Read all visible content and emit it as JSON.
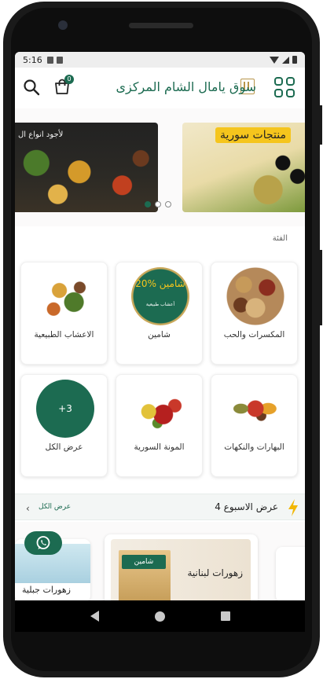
{
  "status_bar": {
    "time": "5:16"
  },
  "header": {
    "title": "سوق يامال الشام المركزى",
    "cart_count": "0"
  },
  "carousel": {
    "banner1_text": "لأجود انواع ال",
    "banner2_text": "منتجات سورية",
    "active_index": 0
  },
  "categories": {
    "section_label": "الفئة",
    "items": [
      {
        "label": "المكسرات والحب",
        "icon": "nuts-image"
      },
      {
        "label": "شامين",
        "icon": "shamin-logo",
        "badge_text": "20% شامين",
        "badge_sub": "أعشاب طبيعية"
      },
      {
        "label": "الاعشاب الطبيعية",
        "icon": "herbs-image"
      },
      {
        "label": "البهارات والنكهات",
        "icon": "spices-image"
      },
      {
        "label": "المونة السورية",
        "icon": "pantry-image"
      },
      {
        "label": "عرض الكل",
        "icon": "more-circle",
        "more_count": "+3"
      }
    ]
  },
  "weekly_offers": {
    "title": "عرض الاسبوع 4",
    "view_all": "عرض الكل"
  },
  "products": [
    {
      "title": "زهورات جبلية"
    },
    {
      "title": "زهورات لبنانية",
      "brand": "شامين"
    }
  ],
  "colors": {
    "primary": "#1c6b51",
    "accent": "#f5c51d",
    "bolt": "#f2b705"
  }
}
